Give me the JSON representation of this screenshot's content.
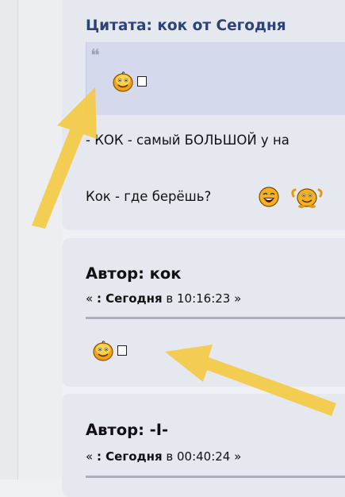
{
  "quote": {
    "header": "Цитата: кок от Сегодня",
    "mark": "❝"
  },
  "post1": {
    "line1": "- КОК - самый БОЛЬШОЙ у на",
    "line2": "Кок - где берёшь?"
  },
  "post2": {
    "author": "Автор: кок",
    "date_open": "« ",
    "date_bold": ": Сегодня",
    "date_rest": " в 10:16:23 »"
  },
  "post3": {
    "author": "Автор: -I-",
    "date_open": "« ",
    "date_bold": ": Сегодня",
    "date_rest": " в 00:40:24 »"
  },
  "colors": {
    "quote_header": "#2d4377",
    "quote_bg": "#d4d9ec",
    "card_bg": "#e5e8ee",
    "arrow": "#f5c83c"
  },
  "icons": [
    "smiley-icon",
    "broken-glyph-icon",
    "laughing-smiley-icon",
    "dancing-smiley-icon",
    "arrow-annotation"
  ]
}
